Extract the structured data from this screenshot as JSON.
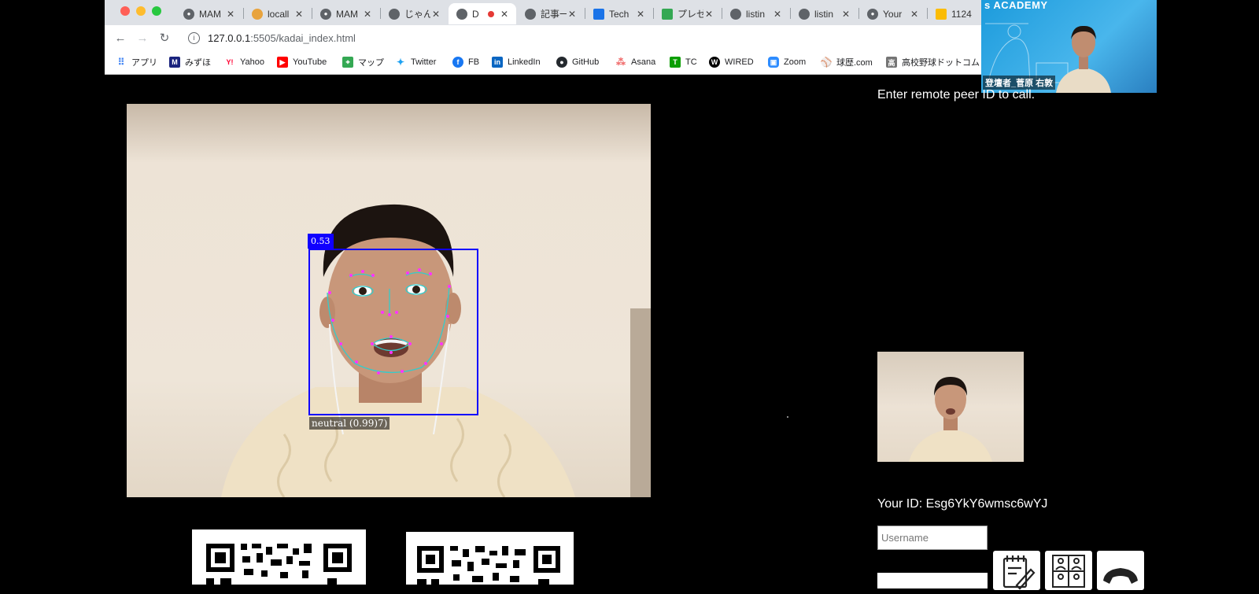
{
  "browser": {
    "tabs": [
      {
        "label": "MAM",
        "icon": "github-icon"
      },
      {
        "label": "locall",
        "icon": "server-icon"
      },
      {
        "label": "MAM",
        "icon": "github-icon"
      },
      {
        "label": "じゃん",
        "icon": "globe-icon"
      },
      {
        "label": "D",
        "icon": "globe-icon",
        "active": true,
        "recording": true
      },
      {
        "label": "記事一",
        "icon": "globe-icon"
      },
      {
        "label": "Tech",
        "icon": "tech-icon"
      },
      {
        "label": "プレゼ",
        "icon": "drive-icon"
      },
      {
        "label": "listin",
        "icon": "globe-icon"
      },
      {
        "label": "listin",
        "icon": "globe-icon"
      },
      {
        "label": "Your",
        "icon": "github-icon"
      },
      {
        "label": "1124",
        "icon": "slides-icon"
      }
    ],
    "url_host": "127.0.0.1",
    "url_path": ":5505/kadai_index.html",
    "bookmarks": [
      {
        "label": "アプリ",
        "icon": "apps-grid-icon",
        "color": "#4285f4"
      },
      {
        "label": "みずほ",
        "icon": "mizuho-icon",
        "color": "#1a237e"
      },
      {
        "label": "Yahoo",
        "icon": "yahoo-icon",
        "color": "#ff0033"
      },
      {
        "label": "YouTube",
        "icon": "youtube-icon",
        "color": "#ff0000"
      },
      {
        "label": "マップ",
        "icon": "maps-icon",
        "color": "#34a853"
      },
      {
        "label": "Twitter",
        "icon": "twitter-icon",
        "color": "#1da1f2"
      },
      {
        "label": "FB",
        "icon": "facebook-icon",
        "color": "#1877f2"
      },
      {
        "label": "LinkedIn",
        "icon": "linkedin-icon",
        "color": "#0a66c2"
      },
      {
        "label": "GitHub",
        "icon": "github-icon",
        "color": "#24292e"
      },
      {
        "label": "Asana",
        "icon": "asana-icon",
        "color": "#f06a6a"
      },
      {
        "label": "TC",
        "icon": "techcrunch-icon",
        "color": "#0a9e01"
      },
      {
        "label": "WIRED",
        "icon": "wired-icon",
        "color": "#000000"
      },
      {
        "label": "Zoom",
        "icon": "zoom-icon",
        "color": "#2d8cff"
      },
      {
        "label": "球歴.com",
        "icon": "baseball-icon",
        "color": "#5c6bc0"
      },
      {
        "label": "高校野球ドットコム",
        "icon": "hs-baseball-icon",
        "color": "#757575"
      }
    ]
  },
  "overlay": {
    "academy_text": "s ACADEMY",
    "participant_name": "登壇者_菅原 右敦"
  },
  "face_detection": {
    "score": "0.53",
    "expression": "neutral (0.99)7)",
    "box_color": "#1000ff",
    "landmark_colors": [
      "#ff33ff",
      "#33cccc"
    ]
  },
  "peer": {
    "prompt": "Enter remote peer ID to call.",
    "your_id": "Your ID: Esg6YkY6wmsc6wYJ",
    "username_placeholder": "Username"
  },
  "buttons": [
    {
      "icon": "notepad-icon"
    },
    {
      "icon": "people-grid-icon"
    },
    {
      "icon": "phone-icon"
    }
  ]
}
